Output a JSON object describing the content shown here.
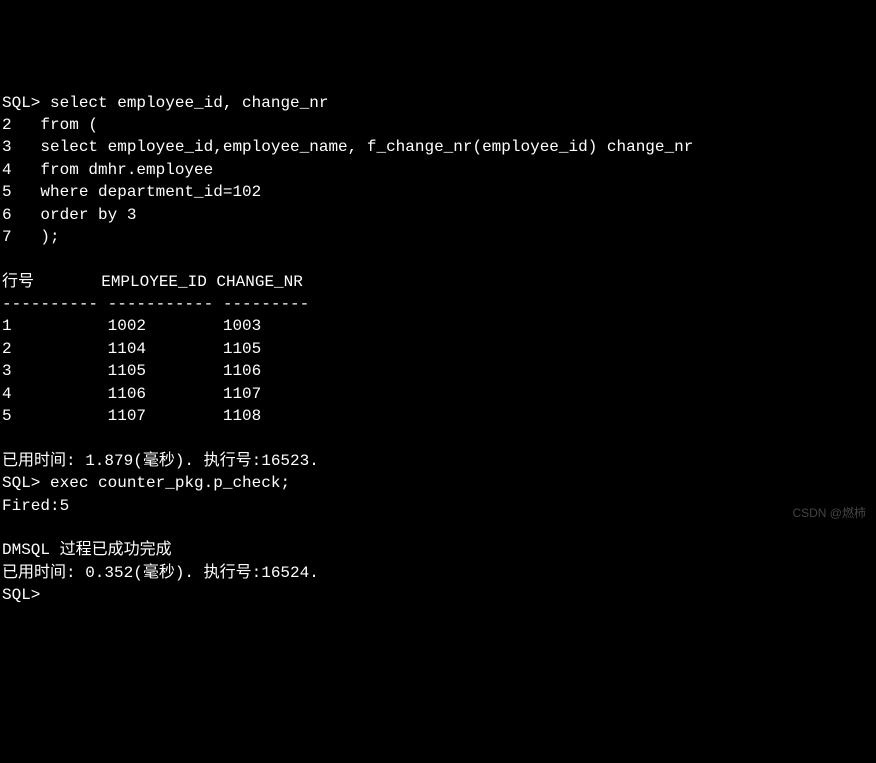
{
  "terminal": {
    "prompt1": "SQL> ",
    "query_lines": {
      "l1": "select employee_id, change_nr",
      "l2": "2   from (",
      "l3": "3   select employee_id,employee_name, f_change_nr(employee_id) change_nr",
      "l4": "4   from dmhr.employee",
      "l5": "5   where department_id=102",
      "l6": "6   order by 3",
      "l7": "7   );"
    },
    "blank": "",
    "header_row": "行号       EMPLOYEE_ID CHANGE_NR",
    "divider_row": "---------- ----------- ---------",
    "result_rows": {
      "r1": "1          1002        1003",
      "r2": "2          1104        1105",
      "r3": "3          1105        1106",
      "r4": "4          1106        1107",
      "r5": "5          1107        1108"
    },
    "timing1": "已用时间: 1.879(毫秒). 执行号:16523.",
    "prompt2": "SQL> ",
    "exec_line": "exec counter_pkg.p_check;",
    "fired_line": "Fired:5",
    "success_line": "DMSQL 过程已成功完成",
    "timing2": "已用时间: 0.352(毫秒). 执行号:16524.",
    "prompt3": "SQL>"
  },
  "watermark": "CSDN @燃柿",
  "chart_data": {
    "type": "table",
    "columns": [
      "行号",
      "EMPLOYEE_ID",
      "CHANGE_NR"
    ],
    "rows": [
      [
        1,
        1002,
        1003
      ],
      [
        2,
        1104,
        1105
      ],
      [
        3,
        1105,
        1106
      ],
      [
        4,
        1106,
        1107
      ],
      [
        5,
        1107,
        1108
      ]
    ],
    "query": "select employee_id, change_nr from ( select employee_id,employee_name, f_change_nr(employee_id) change_nr from dmhr.employee where department_id=102 order by 3 );",
    "timing_ms_1": 1.879,
    "exec_id_1": 16523,
    "exec_command": "exec counter_pkg.p_check;",
    "fired_count": 5,
    "timing_ms_2": 0.352,
    "exec_id_2": 16524
  }
}
